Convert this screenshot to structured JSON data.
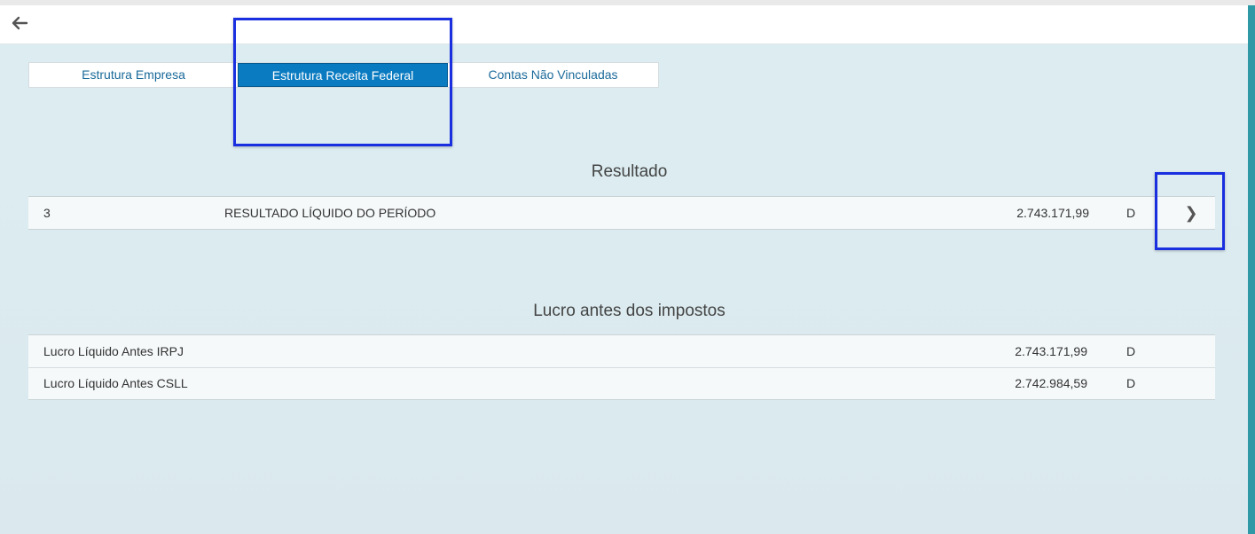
{
  "tabs": [
    {
      "label": "Estrutura Empresa",
      "active": false
    },
    {
      "label": "Estrutura Receita Federal",
      "active": true
    },
    {
      "label": "Contas Não Vinculadas",
      "active": false
    }
  ],
  "icons": {
    "back": "arrow-left-icon",
    "expand": "chevron-right-icon",
    "expand_glyph": "❯"
  },
  "resultado": {
    "title": "Resultado",
    "rows": [
      {
        "code": "3",
        "description": "RESULTADO LÍQUIDO DO PERÍODO",
        "value": "2.743.171,99",
        "dc": "D"
      }
    ]
  },
  "lucro": {
    "title": "Lucro antes dos impostos",
    "rows": [
      {
        "name": "Lucro Líquido Antes IRPJ",
        "value": "2.743.171,99",
        "dc": "D"
      },
      {
        "name": "Lucro Líquido Antes CSLL",
        "value": "2.742.984,59",
        "dc": "D"
      }
    ]
  },
  "colors": {
    "accent": "#0a7bc1",
    "highlight": "#1a2fe0",
    "tab_text": "#1a6a9a"
  }
}
